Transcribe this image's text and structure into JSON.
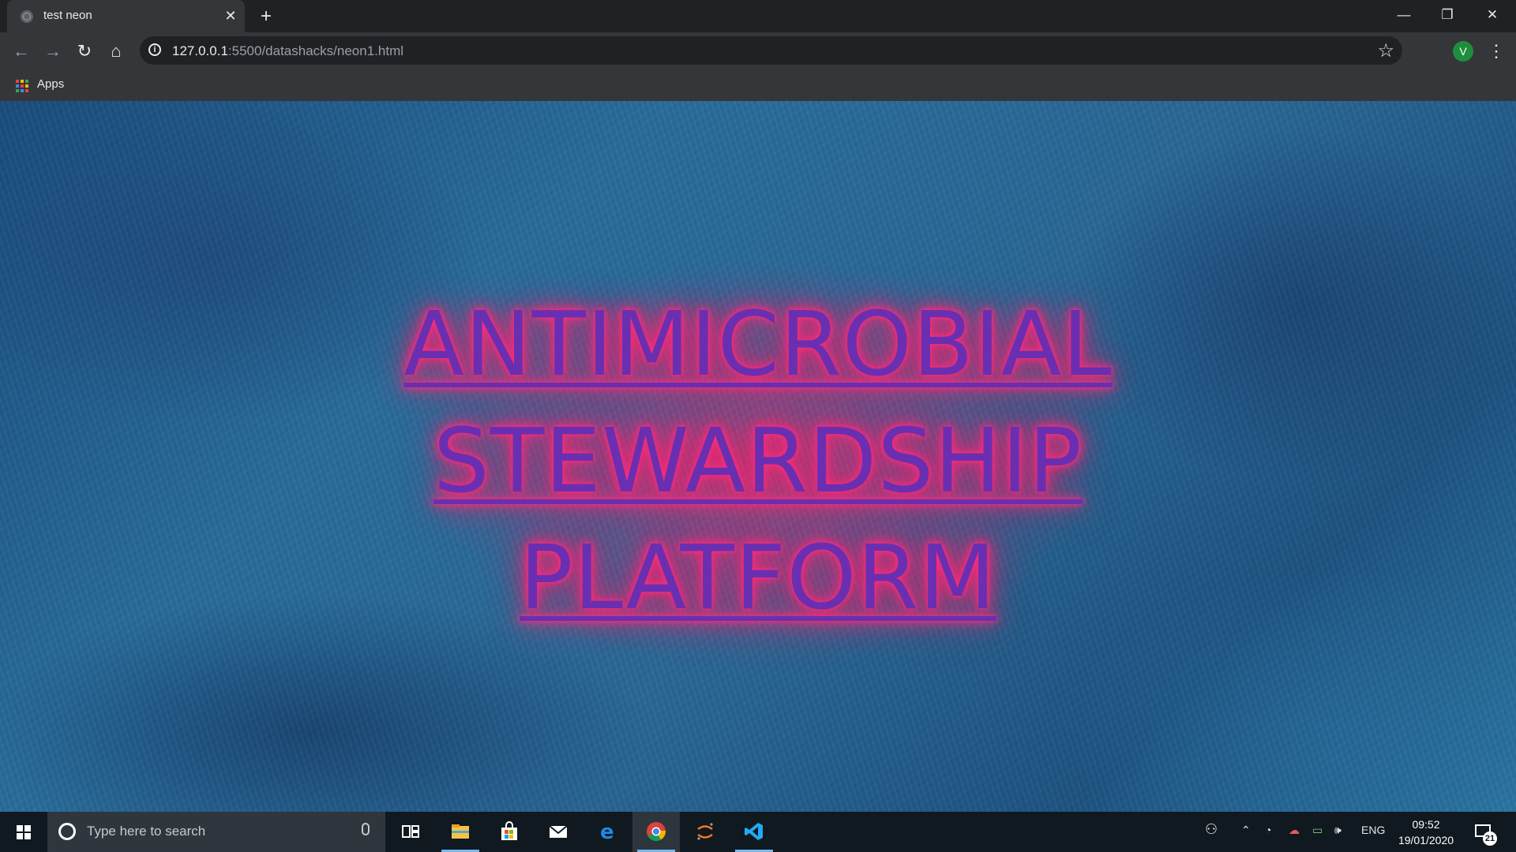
{
  "browser": {
    "tab": {
      "title": "test neon"
    },
    "url": {
      "host": "127.0.0.1",
      "rest": ":5500/datashacks/neon1.html"
    },
    "avatar_letter": "V",
    "bookmarks": [
      {
        "label": "Apps"
      }
    ]
  },
  "page": {
    "heading_lines": [
      "ANTIMICROBIAL",
      "STEWARDSHIP",
      "PLATFORM"
    ],
    "colors": {
      "text": "#6a2fb0",
      "glow": "#ff2c7c",
      "background": "#2a6f9e"
    }
  },
  "taskbar": {
    "search_placeholder": "Type here to search",
    "language": "ENG",
    "time": "09:52",
    "date": "19/01/2020",
    "notification_count": "21",
    "apps": [
      {
        "name": "task-view-icon"
      },
      {
        "name": "file-explorer-icon"
      },
      {
        "name": "microsoft-store-icon"
      },
      {
        "name": "mail-icon"
      },
      {
        "name": "edge-icon"
      },
      {
        "name": "chrome-icon"
      },
      {
        "name": "jupyter-icon"
      },
      {
        "name": "vscode-icon"
      }
    ]
  }
}
